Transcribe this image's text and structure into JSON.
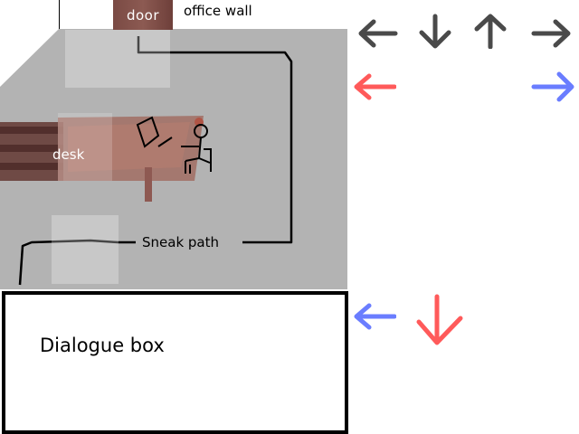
{
  "scene": {
    "door_label": "door",
    "wall_label": "office wall",
    "desk_label": "desk",
    "path_label": "Sneak path"
  },
  "dialogue": {
    "text": "Dialogue box"
  },
  "controls": {
    "gray_row": [
      "left-arrow-icon",
      "down-arrow-icon",
      "up-arrow-icon",
      "right-arrow-icon"
    ],
    "red_left": "left-arrow-icon",
    "blue_right": "right-arrow-icon",
    "blue_left": "left-arrow-icon",
    "red_down": "down-arrow-icon"
  },
  "colors": {
    "gray_arrow": "#4a4a4a",
    "red_arrow": "#ff5a5a",
    "blue_arrow": "#6a7dff",
    "floor": "#b3b3b3",
    "door": "#7a4a44"
  }
}
